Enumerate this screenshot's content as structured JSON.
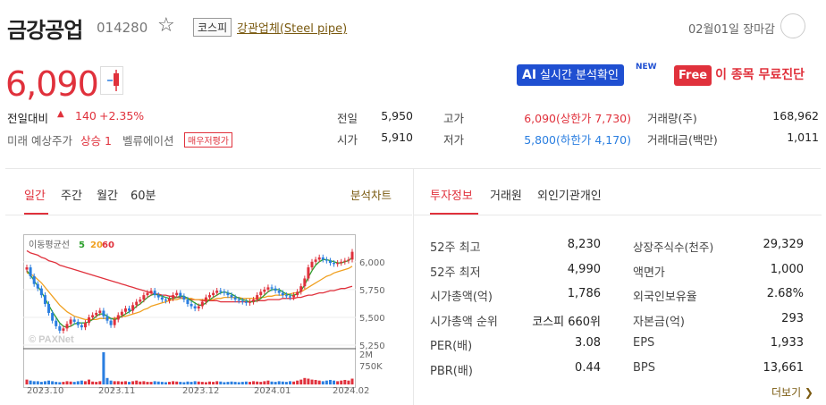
{
  "header": {
    "name": "금강공업",
    "code": "014280",
    "market_badge": "코스피",
    "sector": "강관업체(Steel pipe)",
    "date_status": "02월01일 장마감"
  },
  "price": {
    "current": "6,090",
    "change_label": "전일대비",
    "change_arrow": "▲",
    "change_amount": "140",
    "change_pct": "+2.35%",
    "forecast_label": "미래 예상주가",
    "forecast_value": "상승 1",
    "valuation_label": "벨류에이션",
    "valuation_badge": "매우저평가"
  },
  "buttons": {
    "ai_prefix": "AI",
    "ai_label": "실시간 분석확인",
    "new_tag": "NEW",
    "free_tag": "Free",
    "free_label": "이 종목 무료진단"
  },
  "quote_rows": [
    [
      {
        "label": "전일",
        "value": "5,950",
        "color": "#222"
      },
      {
        "label": "고가",
        "value": "6,090(상한가 7,730)",
        "color": "#e0313c"
      },
      {
        "label": "거래량(주)",
        "value": "168,962",
        "color": "#222"
      }
    ],
    [
      {
        "label": "시가",
        "value": "5,910",
        "color": "#222"
      },
      {
        "label": "저가",
        "value": "5,800(하한가 4,170)",
        "color": "#2a7ee0"
      },
      {
        "label": "거래대금(백만)",
        "value": "1,011",
        "color": "#222"
      }
    ]
  ],
  "chart_tabs": [
    "일간",
    "주간",
    "월간",
    "60분"
  ],
  "chart_link": "분석차트",
  "info_tabs": [
    "투자정보",
    "거래원",
    "외인기관개인"
  ],
  "chart_data": {
    "type": "line",
    "legend": {
      "label": "이동평균선",
      "ma": [
        "5",
        "20",
        "60"
      ],
      "colors": [
        "#2ea12e",
        "#f0a020",
        "#e0313c"
      ]
    },
    "watermark": "© PAXNet",
    "x": [
      "2023.10",
      "2023.11",
      "2023.12",
      "2024.01",
      "2024.02"
    ],
    "y_ticks": [
      "6,000",
      "5,750",
      "5,500",
      "5,250"
    ],
    "ylim": [
      5250,
      6200
    ],
    "close": [
      5950,
      5870,
      5800,
      5760,
      5700,
      5620,
      5540,
      5470,
      5420,
      5380,
      5400,
      5440,
      5480,
      5460,
      5430,
      5410,
      5450,
      5500,
      5520,
      5540,
      5560,
      5510,
      5470,
      5430,
      5480,
      5520,
      5550,
      5580,
      5560,
      5610,
      5640,
      5660,
      5700,
      5720,
      5740,
      5700,
      5680,
      5660,
      5650,
      5670,
      5700,
      5720,
      5690,
      5660,
      5620,
      5600,
      5580,
      5600,
      5640,
      5680,
      5700,
      5720,
      5740,
      5730,
      5720,
      5700,
      5680,
      5660,
      5650,
      5640,
      5630,
      5640,
      5660,
      5700,
      5730,
      5750,
      5770,
      5760,
      5740,
      5720,
      5700,
      5690,
      5680,
      5700,
      5730,
      5780,
      5850,
      5950,
      6000,
      6020,
      6040,
      6020,
      6010,
      5990,
      5980,
      5990,
      6000,
      6010,
      6020,
      6090
    ],
    "ma5": [
      5920,
      5880,
      5830,
      5780,
      5730,
      5670,
      5610,
      5550,
      5500,
      5450,
      5420,
      5410,
      5420,
      5440,
      5450,
      5450,
      5450,
      5460,
      5480,
      5510,
      5530,
      5530,
      5510,
      5490,
      5480,
      5490,
      5510,
      5530,
      5550,
      5570,
      5600,
      5620,
      5650,
      5680,
      5700,
      5710,
      5700,
      5690,
      5680,
      5670,
      5670,
      5680,
      5690,
      5690,
      5670,
      5650,
      5630,
      5610,
      5610,
      5630,
      5660,
      5680,
      5700,
      5720,
      5730,
      5720,
      5710,
      5690,
      5670,
      5660,
      5650,
      5640,
      5640,
      5650,
      5670,
      5700,
      5730,
      5750,
      5750,
      5750,
      5730,
      5710,
      5700,
      5700,
      5710,
      5740,
      5790,
      5860,
      5920,
      5970,
      6000,
      6020,
      6020,
      6010,
      6000,
      5990,
      5990,
      6000,
      6010,
      6040
    ],
    "ma20": [
      5900,
      5890,
      5870,
      5840,
      5810,
      5770,
      5730,
      5690,
      5650,
      5610,
      5580,
      5550,
      5530,
      5510,
      5500,
      5490,
      5480,
      5480,
      5480,
      5480,
      5490,
      5490,
      5490,
      5490,
      5490,
      5500,
      5510,
      5510,
      5520,
      5530,
      5540,
      5550,
      5570,
      5580,
      5600,
      5610,
      5620,
      5630,
      5640,
      5650,
      5660,
      5660,
      5670,
      5670,
      5670,
      5670,
      5660,
      5660,
      5660,
      5660,
      5660,
      5660,
      5670,
      5670,
      5680,
      5680,
      5680,
      5680,
      5680,
      5670,
      5670,
      5670,
      5670,
      5670,
      5680,
      5680,
      5690,
      5690,
      5700,
      5700,
      5700,
      5710,
      5710,
      5720,
      5720,
      5730,
      5750,
      5770,
      5790,
      5810,
      5830,
      5850,
      5870,
      5880,
      5900,
      5910,
      5920,
      5930,
      5940,
      5960
    ],
    "ma60": [
      6100,
      6080,
      6070,
      6060,
      6040,
      6030,
      6010,
      6000,
      5990,
      5970,
      5960,
      5950,
      5940,
      5930,
      5920,
      5910,
      5900,
      5890,
      5880,
      5870,
      5860,
      5850,
      5840,
      5830,
      5820,
      5810,
      5800,
      5790,
      5780,
      5770,
      5760,
      5750,
      5740,
      5730,
      5720,
      5710,
      5710,
      5700,
      5700,
      5690,
      5690,
      5680,
      5680,
      5670,
      5670,
      5660,
      5660,
      5660,
      5650,
      5650,
      5650,
      5650,
      5650,
      5640,
      5640,
      5640,
      5640,
      5640,
      5640,
      5640,
      5640,
      5640,
      5650,
      5650,
      5650,
      5650,
      5660,
      5660,
      5660,
      5660,
      5670,
      5670,
      5670,
      5670,
      5680,
      5680,
      5690,
      5700,
      5700,
      5710,
      5720,
      5720,
      5730,
      5740,
      5740,
      5750,
      5760,
      5760,
      5770,
      5780
    ],
    "volume_ticks": [
      "2M",
      "750K"
    ],
    "volume": [
      0.15,
      0.12,
      0.1,
      0.1,
      0.08,
      0.1,
      0.12,
      0.1,
      0.08,
      0.07,
      0.08,
      0.1,
      0.09,
      0.08,
      0.1,
      0.12,
      0.1,
      0.15,
      0.09,
      0.08,
      0.1,
      1.0,
      0.2,
      0.12,
      0.1,
      0.1,
      0.09,
      0.1,
      0.08,
      0.1,
      0.12,
      0.09,
      0.1,
      0.08,
      0.08,
      0.1,
      0.09,
      0.08,
      0.07,
      0.08,
      0.1,
      0.09,
      0.08,
      0.07,
      0.09,
      0.08,
      0.1,
      0.09,
      0.08,
      0.07,
      0.09,
      0.08,
      0.1,
      0.09,
      0.07,
      0.08,
      0.09,
      0.08,
      0.07,
      0.08,
      0.09,
      0.08,
      0.1,
      0.09,
      0.08,
      0.1,
      0.12,
      0.09,
      0.08,
      0.1,
      0.09,
      0.08,
      0.1,
      0.09,
      0.12,
      0.15,
      0.2,
      0.18,
      0.15,
      0.14,
      0.12,
      0.1,
      0.12,
      0.14,
      0.12,
      0.1,
      0.12,
      0.14,
      0.12,
      0.18
    ]
  },
  "info_left": [
    {
      "label": "52주 최고",
      "value": "8,230"
    },
    {
      "label": "52주 최저",
      "value": "4,990"
    },
    {
      "label": "시가총액(억)",
      "value": "1,786"
    },
    {
      "label": "시가총액 순위",
      "value": "코스피 660위"
    },
    {
      "label": "PER(배)",
      "value": "3.08"
    },
    {
      "label": "PBR(배)",
      "value": "0.44"
    }
  ],
  "info_right": [
    {
      "label": "상장주식수(천주)",
      "value": "29,329"
    },
    {
      "label": "액면가",
      "value": "1,000"
    },
    {
      "label": "외국인보유율",
      "value": "2.68%"
    },
    {
      "label": "자본금(억)",
      "value": "293"
    },
    {
      "label": "EPS",
      "value": "1,933"
    },
    {
      "label": "BPS",
      "value": "13,661"
    }
  ],
  "more_link": "더보기 ❯"
}
